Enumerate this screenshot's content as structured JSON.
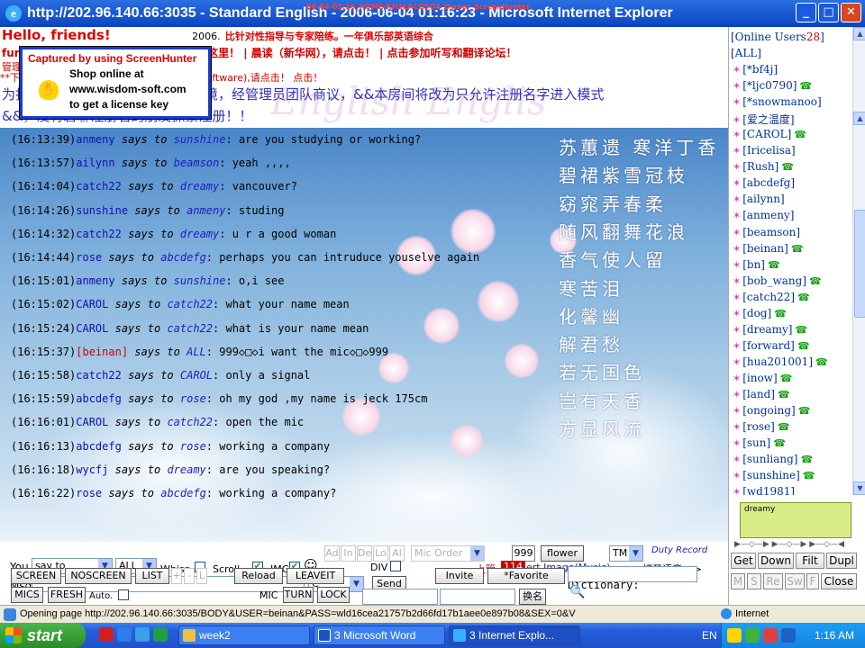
{
  "window": {
    "title": "http://202.96.140.66:3035 - Standard English - 2006-06-04 01:16:23 - Microsoft Internet Explorer",
    "overlay_caption": "06-04-01:16_HOME-KH3LACG5O4_Owner_ScreenHunter",
    "controls": {
      "minimize": "_",
      "maximize": "□",
      "close": "✕"
    }
  },
  "header": {
    "line1_red": "Hello, friends!",
    "line1_black": "2006.",
    "line1_red2": "比针对性指导与专家陪练。一年俱乐部英语综合",
    "line2_left": "fur",
    "line2_right": "这里！ | 晨读（新华网），请点击！ | 点击参加听写和翻译论坛！",
    "line3": "管理",
    "line4": "**下载碧聊语音聊天软件（Download voice software),请点击！ 点击！",
    "line5": "为打造与保持纯粹英语交流练习环境，经管理员团队商议，&&本房间将改为只允许注册名字进入模式",
    "line6": "&&，没有碧聊注册名的朋友抓紧注册！！",
    "watermark": "English  Englis"
  },
  "notice": {
    "line1": "Captured by using ScreenHunter",
    "line2": "Shop online at",
    "line3": "www.wisdom-soft.com",
    "line4": "to get a license key",
    "hand_icon": "hand-icon"
  },
  "messages": [
    {
      "time": "(16:13:39)",
      "from": "anmeny",
      "to": "sunshine",
      "text": ": are you studying or working?",
      "red": false
    },
    {
      "time": "(16:13:57)",
      "from": "ailynn",
      "to": "beamson",
      "text": ": yeah ,,,,",
      "red": false
    },
    {
      "time": "(16:14:04)",
      "from": "catch22",
      "to": "dreamy",
      "text": ": vancouver?",
      "red": false
    },
    {
      "time": "(16:14:26)",
      "from": "sunshine",
      "to": "anmeny",
      "text": ": studing",
      "red": false
    },
    {
      "time": "(16:14:32)",
      "from": "catch22",
      "to": "dreamy",
      "text": ": u r a good woman",
      "red": false
    },
    {
      "time": "(16:14:44)",
      "from": "rose",
      "to": "abcdefg",
      "text": ": perhaps you can intruduce youselve again",
      "red": false
    },
    {
      "time": "(16:15:01)",
      "from": "anmeny",
      "to": "sunshine",
      "text": ": o,i see",
      "red": false
    },
    {
      "time": "(16:15:02)",
      "from": "CAROL",
      "to": "catch22",
      "text": ": what your name mean",
      "red": false
    },
    {
      "time": "(16:15:24)",
      "from": "CAROL",
      "to": "catch22",
      "text": ": what is your name mean",
      "red": false
    },
    {
      "time": "(16:15:37)",
      "from": "[beinan]",
      "to": "ALL",
      "text": ": 999◇□◇i want the mic◇□◇999",
      "red": true
    },
    {
      "time": "(16:15:58)",
      "from": "catch22",
      "to": "CAROL",
      "text": ": only a signal",
      "red": false
    },
    {
      "time": "(16:15:59)",
      "from": "abcdefg",
      "to": "rose",
      "text": ": oh my god ,my name is jeck 175cm",
      "red": false
    },
    {
      "time": "(16:16:01)",
      "from": "CAROL",
      "to": "catch22",
      "text": ": open the mic",
      "red": false
    },
    {
      "time": "(16:16:13)",
      "from": "abcdefg",
      "to": "rose",
      "text": ": working a company",
      "red": false
    },
    {
      "time": "(16:16:18)",
      "from": "wycfj",
      "to": "dreamy",
      "text": ": are you speaking?",
      "red": false
    },
    {
      "time": "(16:16:22)",
      "from": "rose",
      "to": "abcdefg",
      "text": ": working a company?",
      "red": false
    }
  ],
  "says_word": "says",
  "to_word": "to",
  "poem": [
    "苏蕙遗 寒洋丁香",
    "碧裙紫雪冠枝",
    "窈窕弄春柔",
    "随风翻舞花浪",
    "香气使人留",
    "寒苦泪",
    "化馨幽",
    "解君愁",
    "若无国色",
    "岂有天香",
    "方显风流"
  ],
  "controls": {
    "you_label": "You",
    "say_to_value": "say to",
    "target_value": "ALL",
    "whisp_label": "Whisp.",
    "scroll_label": "Scroll.",
    "img_label": "IMG",
    "smiley": "☺",
    "ad_buttons": [
      "Ad",
      "In",
      "De",
      "Lo",
      "Al"
    ],
    "mic_order_value": "Mic Order",
    "num_value": "999",
    "flower_label": "flower",
    "tm_value": "TM",
    "duty_record": "Duty Record",
    "div_label": "DIV",
    "admin_label": "上管",
    "admin_count": "114",
    "insert_image": "ert Image(Music)",
    "open_voice": "打开语音 =>",
    "msg_label": "Msg",
    "c_value": "C",
    "send_label": "Send",
    "dictionary_label": "Dictionary:",
    "screen_label": "SCREEN",
    "noscreen_label": "NOSCREEN",
    "list_label": "LIST",
    "plus": "+",
    "minus": "-",
    "l": "L",
    "reload_label": "Reload",
    "leaveit_label": "LEAVEIT",
    "invite_label": "Invite",
    "favorite_label": "*Favorite",
    "mics_label": "MICS",
    "fresh_label": "FRESH",
    "auto_label": "Auto.",
    "mic_label": "MIC",
    "turn_label": "TURN",
    "lock_label": "LOCK",
    "rename_label": "换名"
  },
  "users": {
    "header": "[Online Users",
    "count": "28",
    "all": "[ALL]",
    "list": [
      {
        "name": "[*bf4j]",
        "phone": false
      },
      {
        "name": "[*ljc0790]",
        "phone": true
      },
      {
        "name": "[*snowmanoo]",
        "phone": false
      },
      {
        "name": "[爱之温度]",
        "phone": false
      },
      {
        "name": "[CAROL]",
        "phone": true
      },
      {
        "name": "[Iricelisa]",
        "phone": false
      },
      {
        "name": "[Rush]",
        "phone": true
      },
      {
        "name": "[abcdefg]",
        "phone": false
      },
      {
        "name": "[ailynn]",
        "phone": false
      },
      {
        "name": "[anmeny]",
        "phone": false
      },
      {
        "name": "[beamson]",
        "phone": false
      },
      {
        "name": "[beinan]",
        "phone": true
      },
      {
        "name": "[bn]",
        "phone": true
      },
      {
        "name": "[bob_wang]",
        "phone": true
      },
      {
        "name": "[catch22]",
        "phone": true
      },
      {
        "name": "[dog]",
        "phone": true
      },
      {
        "name": "[dreamy]",
        "phone": true
      },
      {
        "name": "[forward]",
        "phone": true
      },
      {
        "name": "[hua201001]",
        "phone": true
      },
      {
        "name": "[inow]",
        "phone": true
      },
      {
        "name": "[land]",
        "phone": true
      },
      {
        "name": "[ongoing]",
        "phone": true
      },
      {
        "name": "[rose]",
        "phone": true
      },
      {
        "name": "[sun]",
        "phone": true
      },
      {
        "name": "[sunliang]",
        "phone": true
      },
      {
        "name": "[sunshine]",
        "phone": true
      },
      {
        "name": "[wd1981]",
        "phone": false
      }
    ],
    "star": "✶",
    "phone_glyph": "☎"
  },
  "voice": {
    "box_text": "dreamy"
  },
  "right_buttons": {
    "get": "Get",
    "down": "Down",
    "filt": "Filt",
    "dupl": "Dupl",
    "m": "M",
    "s": "S",
    "re": "Re",
    "sw": "Sw",
    "f": "F",
    "close": "Close"
  },
  "status": {
    "text": "Opening page http://202.96.140.66:3035/BODY&USER=beinan&PASS=wld16cea21757b2d66fd17b1aee0e897b08&SEX=0&V",
    "zone": "Internet"
  },
  "taskbar": {
    "start": "start",
    "tasks": [
      "week2",
      "3 Microsoft Word",
      "3 Internet Explo..."
    ],
    "lang": "EN",
    "clock": "1:16 AM"
  },
  "colors": {
    "title_bar": "#0a43c3",
    "chat_bg": "#7eb0dc",
    "accent_red": "#d00000",
    "user_blue": "#0030a0"
  }
}
